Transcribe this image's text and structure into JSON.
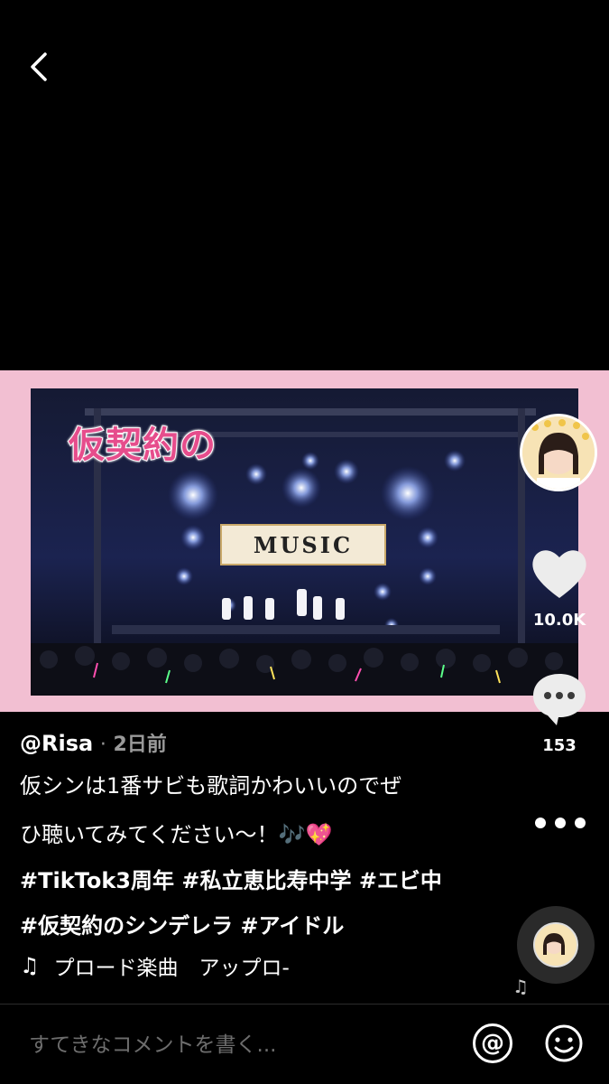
{
  "video": {
    "overlay_caption": "仮契約の",
    "banner_text": "MUSIC"
  },
  "rail": {
    "like_count": "10.0K",
    "comment_count": "153"
  },
  "post": {
    "username": "@Risa",
    "separator": "·",
    "time": "2日前",
    "description_lines": [
      "仮シンは1番サビも歌詞かわいいのでぜ",
      "ひ聴いてみてください〜！🎶💖"
    ],
    "hashtag_lines": [
      "#TikTok3周年 #私立恵比寿中学 #エビ中",
      "#仮契約のシンデレラ #アイドル"
    ],
    "music": "プロード楽曲　アップロ-"
  },
  "comment_bar": {
    "placeholder": "すてきなコメントを書く...",
    "at_symbol": "@"
  },
  "icons": {
    "back": "chevron-left-icon",
    "like": "heart-icon",
    "comment": "speech-bubble-icon",
    "more": "ellipsis-icon",
    "music": "music-note-icon",
    "emoji": "smiley-icon"
  },
  "colors": {
    "video_frame": "#f2bfd2",
    "overlay_caption": "#e64d8c",
    "secondary_text": "#9a9a9a",
    "placeholder_text": "#6d6d6d"
  }
}
